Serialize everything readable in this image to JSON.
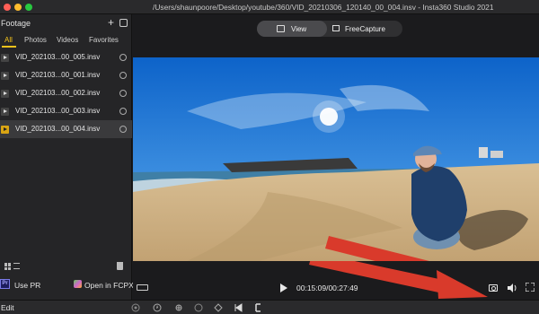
{
  "window": {
    "title": "/Users/shaunpoore/Desktop/youtube/360/VID_20210306_120140_00_004.insv - Insta360 Studio 2021"
  },
  "sidebar": {
    "title": "Footage",
    "tabs": [
      {
        "label": "All",
        "active": true
      },
      {
        "label": "Photos",
        "active": false
      },
      {
        "label": "Videos",
        "active": false
      },
      {
        "label": "Favorites",
        "active": false
      }
    ],
    "files": [
      {
        "name": "VID_202103...00_005.insv",
        "selected": false
      },
      {
        "name": "VID_202103...00_001.insv",
        "selected": false
      },
      {
        "name": "VID_202103...00_002.insv",
        "selected": false
      },
      {
        "name": "VID_202103...00_003.insv",
        "selected": false
      },
      {
        "name": "VID_202103...00_004.insv",
        "selected": true
      }
    ],
    "actions": {
      "premiere_label": "Use PR",
      "premiere_icon_text": "Pr",
      "fcpx_label": "Open in FCPX"
    }
  },
  "main": {
    "mode_toggle": {
      "view_label": "View",
      "freecapture_label": "FreeCapture",
      "selected": "View"
    },
    "player": {
      "timecode": "00:15:09/00:27:49"
    }
  },
  "bottombar": {
    "edit_label": "Edit"
  },
  "colors": {
    "accent": "#f2c21b",
    "annotation_arrow": "#d93a2b"
  }
}
